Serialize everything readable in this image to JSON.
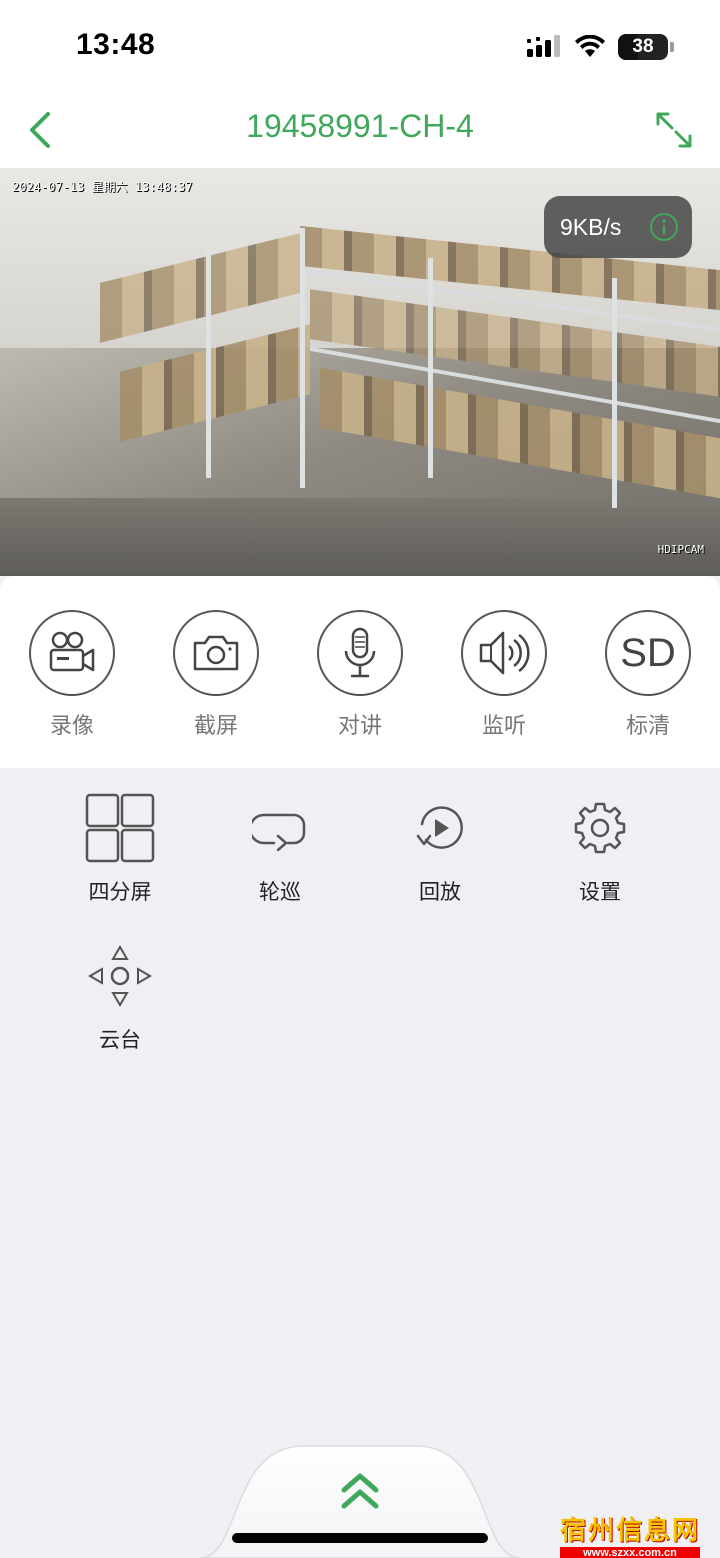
{
  "status_bar": {
    "time": "13:48",
    "battery_level": "38",
    "icons": [
      "signal-icon",
      "wifi-icon",
      "battery-icon"
    ]
  },
  "nav": {
    "title": "19458991-CH-4",
    "back_icon": "chevron-left-icon",
    "expand_icon": "fullscreen-icon",
    "accent_color": "#3fa85a"
  },
  "video": {
    "osd_timestamp": "2024-07-13 星期六 13:48:37",
    "osd_brand": "HDIPCAM",
    "speed": "9KB/s",
    "info_icon": "info-icon"
  },
  "controls": [
    {
      "label": "录像",
      "icon": "video-camera-icon"
    },
    {
      "label": "截屏",
      "icon": "camera-icon"
    },
    {
      "label": "对讲",
      "icon": "microphone-icon"
    },
    {
      "label": "监听",
      "icon": "speaker-icon"
    },
    {
      "label": "标清",
      "icon": "sd-icon",
      "icon_text": "SD"
    }
  ],
  "functions": [
    {
      "label": "四分屏",
      "icon": "grid-icon"
    },
    {
      "label": "轮巡",
      "icon": "cycle-icon"
    },
    {
      "label": "回放",
      "icon": "playback-icon"
    },
    {
      "label": "设置",
      "icon": "gear-icon"
    },
    {
      "label": "云台",
      "icon": "ptz-icon"
    }
  ],
  "bottom": {
    "expand_icon": "double-chevron-up-icon"
  },
  "watermark": {
    "title": "宿州信息网",
    "url": "www.szxx.com.cn"
  }
}
